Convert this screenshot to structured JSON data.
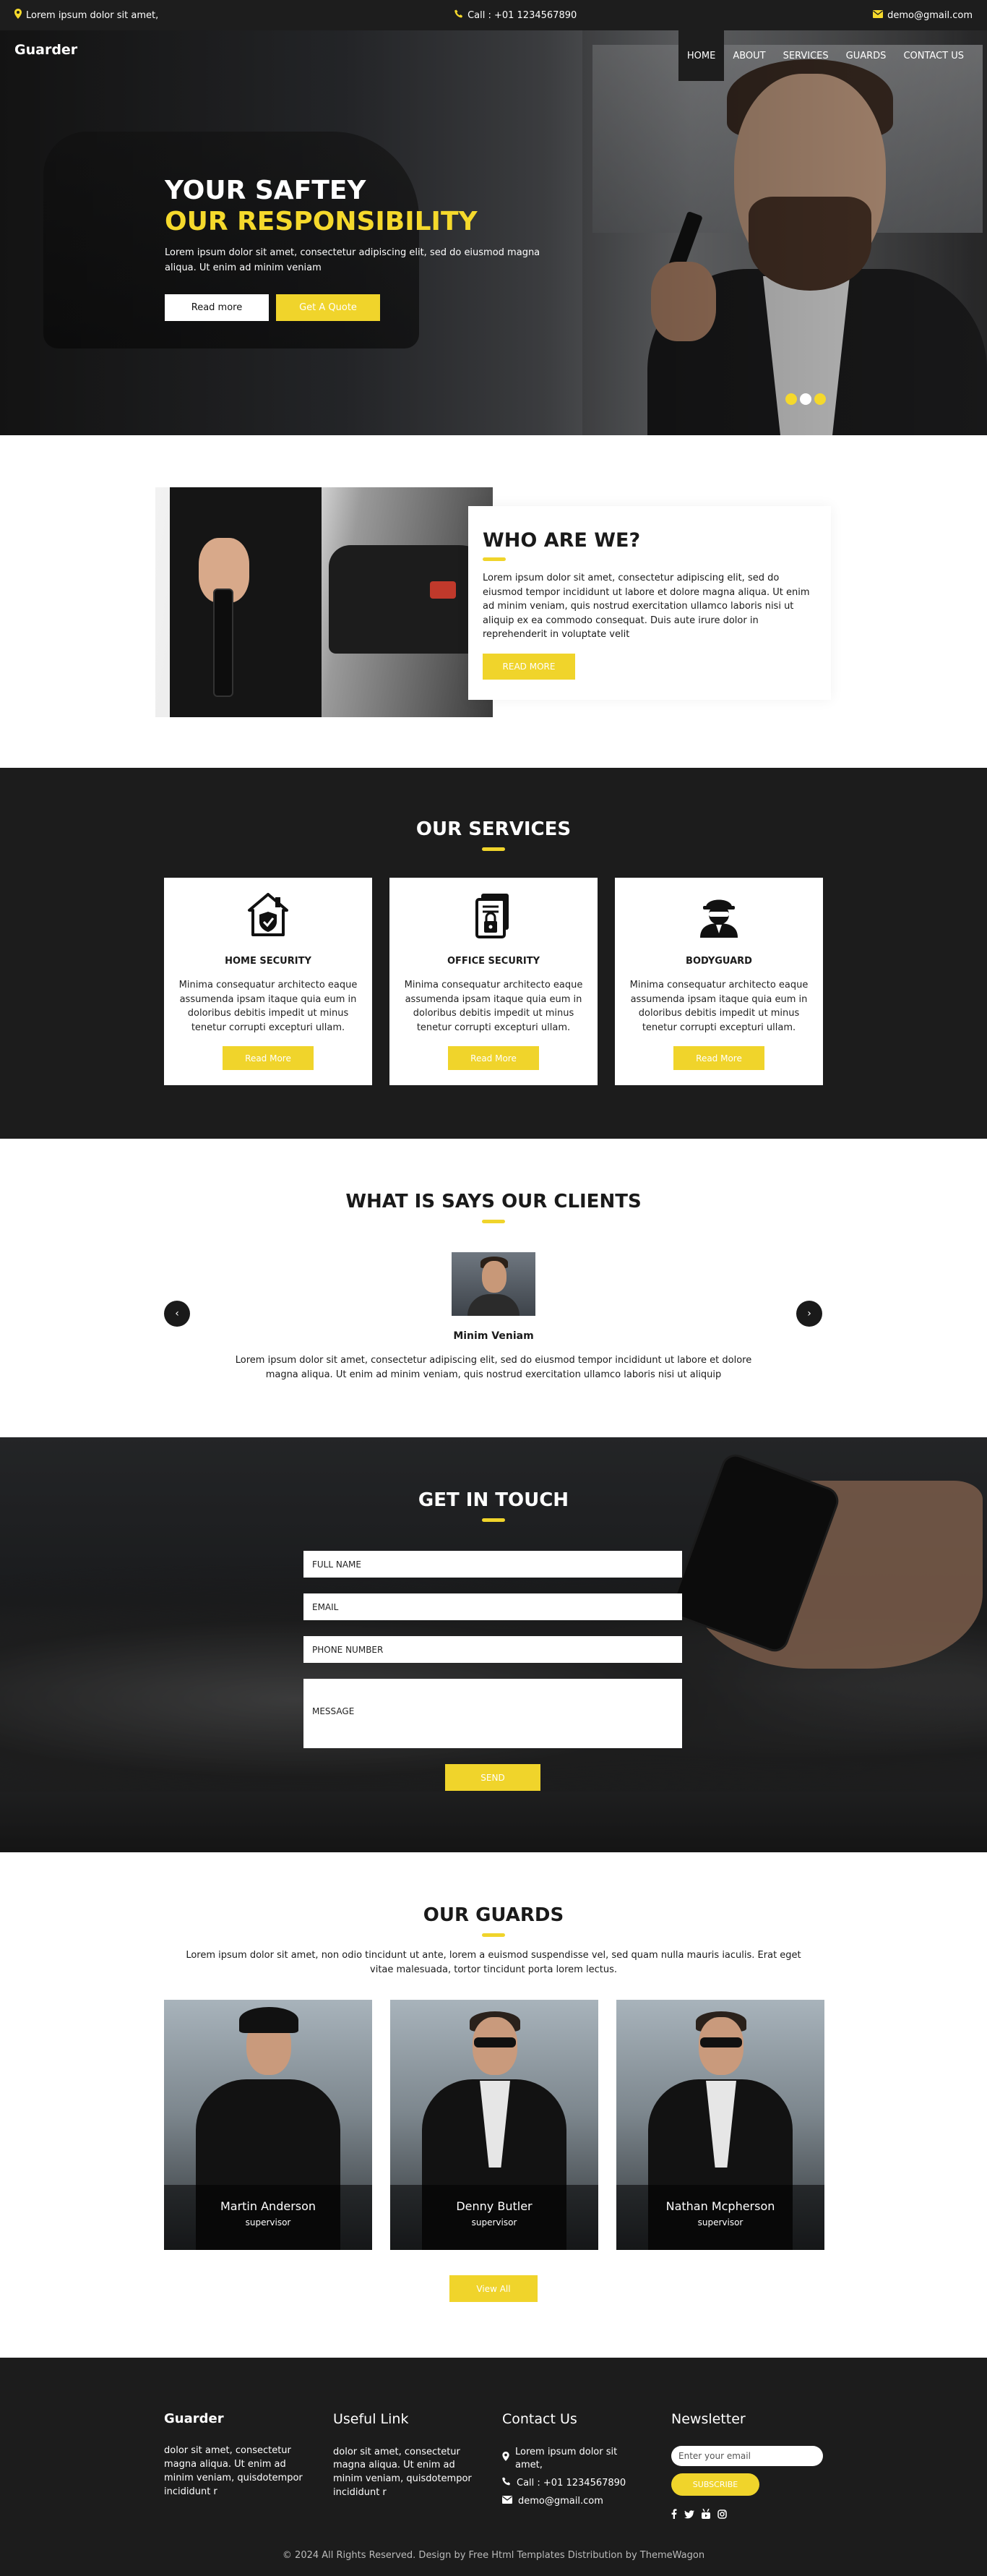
{
  "topbar": {
    "address": "Lorem ipsum dolor sit amet,",
    "phone": "Call : +01 1234567890",
    "email": "demo@gmail.com"
  },
  "nav": {
    "brand": "Guarder",
    "items": [
      "HOME",
      "ABOUT",
      "SERVICES",
      "GUARDS",
      "CONTACT US"
    ],
    "active": "HOME"
  },
  "hero": {
    "title_line1": "YOUR SAFTEY",
    "title_line2": "OUR RESPONSIBILITY",
    "text": "Lorem ipsum dolor sit amet, consectetur adipiscing elit, sed do eiusmod magna aliqua. Ut enim ad minim veniam",
    "btn_read": "Read more",
    "btn_quote": "Get A Quote",
    "slides": 3,
    "active_slide": 2
  },
  "about": {
    "title": "WHO ARE WE?",
    "text": "Lorem ipsum dolor sit amet, consectetur adipiscing elit, sed do eiusmod tempor incididunt ut labore et dolore magna aliqua. Ut enim ad minim veniam, quis nostrud exercitation ullamco laboris nisi ut aliquip ex ea commodo consequat. Duis aute irure dolor in reprehenderit in voluptate velit",
    "button": "READ MORE"
  },
  "services": {
    "title": "OUR SERVICES",
    "items": [
      {
        "title": "HOME SECURITY",
        "icon": "home-shield-icon",
        "text": "Minima consequatur architecto eaque assumenda ipsam itaque quia eum in doloribus debitis impedit ut minus tenetur corrupti excepturi ullam.",
        "button": "Read More"
      },
      {
        "title": "OFFICE SECURITY",
        "icon": "office-lock-icon",
        "text": "Minima consequatur architecto eaque assumenda ipsam itaque quia eum in doloribus debitis impedit ut minus tenetur corrupti excepturi ullam.",
        "button": "Read More"
      },
      {
        "title": "BODYGUARD",
        "icon": "bodyguard-icon",
        "text": "Minima consequatur architecto eaque assumenda ipsam itaque quia eum in doloribus debitis impedit ut minus tenetur corrupti excepturi ullam.",
        "button": "Read More"
      }
    ]
  },
  "clients": {
    "title": "WHAT IS SAYS OUR CLIENTS",
    "name": "Minim Veniam",
    "text": "Lorem ipsum dolor sit amet, consectetur adipiscing elit, sed do eiusmod tempor incididunt ut labore et dolore magna aliqua. Ut enim ad minim veniam, quis nostrud exercitation ullamco laboris nisi ut aliquip",
    "prev": "‹",
    "next": "›"
  },
  "contact": {
    "title": "GET IN TOUCH",
    "placeholders": {
      "name": "FULL NAME",
      "email": "EMAIL",
      "phone": "PHONE NUMBER",
      "message": "MESSAGE"
    },
    "send": "SEND"
  },
  "guards": {
    "title": "OUR GUARDS",
    "intro": "Lorem ipsum dolor sit amet, non odio tincidunt ut ante, lorem a euismod suspendisse vel, sed quam nulla mauris iaculis. Erat eget vitae malesuada, tortor tincidunt porta lorem lectus.",
    "items": [
      {
        "name": "Martin Anderson",
        "role": "supervisor"
      },
      {
        "name": "Denny Butler",
        "role": "supervisor"
      },
      {
        "name": "Nathan Mcpherson",
        "role": "supervisor"
      }
    ],
    "view_all": "View All"
  },
  "footer": {
    "brand": "Guarder",
    "brand_text": "dolor sit amet, consectetur magna aliqua. Ut enim ad minim veniam, quisdotempor incididunt r",
    "useful_title": "Useful Link",
    "useful_text": "dolor sit amet, consectetur magna aliqua. Ut enim ad minim veniam, quisdotempor incididunt r",
    "contact_title": "Contact Us",
    "contact_address": "Lorem ipsum dolor sit amet,",
    "contact_phone": "Call : +01 1234567890",
    "contact_email": "demo@gmail.com",
    "newsletter_title": "Newsletter",
    "newsletter_placeholder": "Enter your email",
    "subscribe": "SUBSCRIBE",
    "socials": [
      "facebook-icon",
      "twitter-icon",
      "youtube-icon",
      "instagram-icon"
    ],
    "copyright": "© 2024 All Rights Reserved. Design by Free Html Templates Distribution by ThemeWagon"
  },
  "colors": {
    "accent": "#f0d42b",
    "dark": "#1c1c1c"
  }
}
